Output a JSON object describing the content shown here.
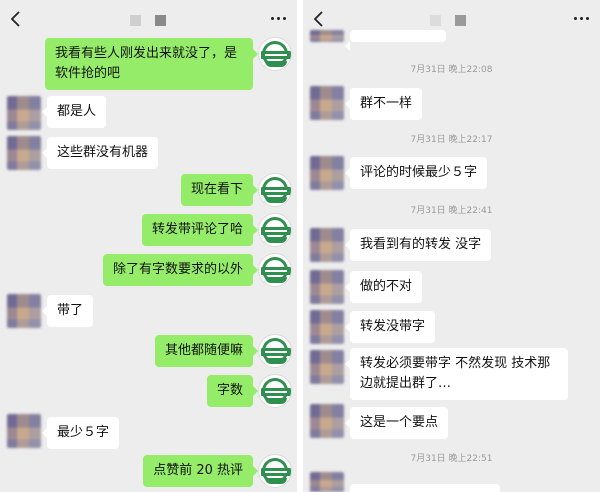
{
  "left": {
    "header": {
      "title_block_colors": [
        "#cfcfcf",
        "#8a8a8a"
      ]
    },
    "messages": [
      {
        "side": "right",
        "text": "我看有些人刚发出来就没了，是软件抢的吧"
      },
      {
        "side": "left",
        "text": "都是人"
      },
      {
        "side": "left",
        "text": "这些群没有机器"
      },
      {
        "side": "right",
        "text": "现在看下"
      },
      {
        "side": "right",
        "text": "转发带评论了哈"
      },
      {
        "side": "right",
        "text": "除了有字数要求的以外"
      },
      {
        "side": "left",
        "text": "带了"
      },
      {
        "side": "right",
        "text": "其他都随便嘛"
      },
      {
        "side": "right",
        "text": "字数"
      },
      {
        "side": "left",
        "text": "最少５字"
      },
      {
        "side": "right",
        "text": "点赞前 20 热评"
      }
    ]
  },
  "right": {
    "header": {
      "title_block_colors": [
        "#dcdcdc",
        "#9a9a9a"
      ]
    },
    "timestamps": [
      "7月31日 晚上22:08",
      "7月31日 晚上22:17",
      "7月31日 晚上22:41",
      "7月31日 晚上22:51"
    ],
    "messages": [
      {
        "side": "left",
        "text": "群不一样"
      },
      {
        "side": "left",
        "text": "评论的时候最少５字"
      },
      {
        "side": "left",
        "text": "我看到有的转发 没字"
      },
      {
        "side": "left",
        "text": "做的不对"
      },
      {
        "side": "left",
        "text": "转发没带字"
      },
      {
        "side": "left",
        "text": "转发必须要带字 不然发现 技术那边就提出群了…"
      },
      {
        "side": "left",
        "text": "这是一个要点"
      }
    ]
  },
  "colors": {
    "chat_bg": "#ededed",
    "bubble_green": "#95ec69",
    "bubble_white": "#ffffff",
    "logo_green": "#2f8f4e"
  },
  "icons": {
    "back": "chevron-left-icon",
    "more": "more-dots-icon"
  }
}
